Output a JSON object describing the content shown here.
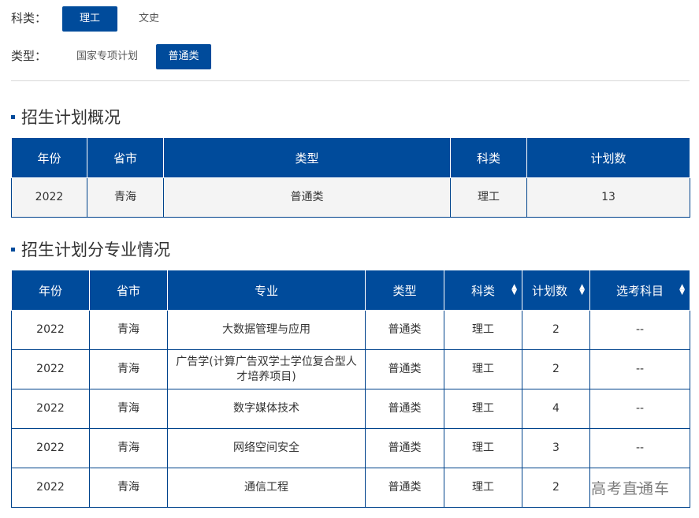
{
  "filters": {
    "subject": {
      "label": "科类：",
      "options": [
        "理工",
        "文史"
      ],
      "selected": "理工"
    },
    "type": {
      "label": "类型：",
      "options": [
        "国家专项计划",
        "普通类"
      ],
      "selected": "普通类"
    }
  },
  "overview": {
    "title": "招生计划概况",
    "columns": [
      "年份",
      "省市",
      "类型",
      "科类",
      "计划数"
    ],
    "rows": [
      [
        "2022",
        "青海",
        "普通类",
        "理工",
        "13"
      ]
    ]
  },
  "majors": {
    "title": "招生计划分专业情况",
    "columns": [
      "年份",
      "省市",
      "专业",
      "类型",
      "科类",
      "计划数",
      "选考科目"
    ],
    "rows": [
      [
        "2022",
        "青海",
        "大数据管理与应用",
        "普通类",
        "理工",
        "2",
        "--"
      ],
      [
        "2022",
        "青海",
        "广告学(计算广告双学士学位复合型人才培养项目)",
        "普通类",
        "理工",
        "2",
        "--"
      ],
      [
        "2022",
        "青海",
        "数字媒体技术",
        "普通类",
        "理工",
        "4",
        "--"
      ],
      [
        "2022",
        "青海",
        "网络空间安全",
        "普通类",
        "理工",
        "3",
        "--"
      ],
      [
        "2022",
        "青海",
        "通信工程",
        "普通类",
        "理工",
        "2",
        "--"
      ]
    ]
  },
  "watermark": "高考直通车",
  "colors": {
    "accent": "#004b9b",
    "border": "#00438c"
  }
}
